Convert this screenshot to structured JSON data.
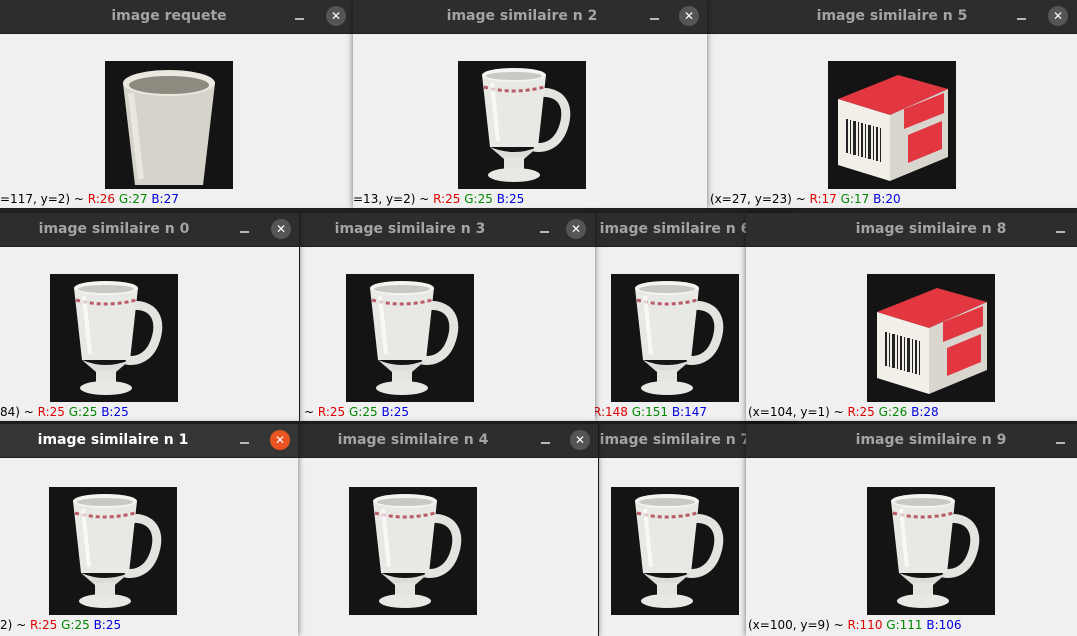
{
  "windows": [
    {
      "id": "requete",
      "title": "image requete",
      "image": "cup-icon",
      "status": {
        "coord": "=117, y=2)",
        "sep": " ~ ",
        "r": "R:26",
        "g": "G:27",
        "b": "B:27"
      }
    },
    {
      "id": "n2",
      "title": "image similaire n 2",
      "image": "mug-icon",
      "status": {
        "coord": "=13, y=2)",
        "sep": " ~ ",
        "r": "R:25",
        "g": "G:25",
        "b": "B:25"
      }
    },
    {
      "id": "n5",
      "title": "image similaire n 5",
      "image": "tylenol-box-icon",
      "status": {
        "coord": "(x=27, y=23)",
        "sep": " ~ ",
        "r": "R:17",
        "g": "G:17",
        "b": "B:20"
      }
    },
    {
      "id": "n0",
      "title": "image similaire n 0",
      "image": "mug-icon",
      "status": {
        "coord": "84)",
        "sep": " ~ ",
        "r": "R:25",
        "g": "G:25",
        "b": "B:25"
      }
    },
    {
      "id": "n3",
      "title": "image similaire n 3",
      "image": "mug-icon",
      "status": {
        "coord": "",
        "sep": " ~ ",
        "r": "R:25",
        "g": "G:25",
        "b": "B:25"
      }
    },
    {
      "id": "n6",
      "title": "image similaire n 6",
      "image": "mug-icon",
      "status": {
        "coord": "",
        "sep": "",
        "r": "R:148",
        "g": "G:151",
        "b": "B:147"
      }
    },
    {
      "id": "n8",
      "title": "image similaire n 8",
      "image": "tylenol-box-icon",
      "status": {
        "coord": "(x=104, y=1)",
        "sep": " ~ ",
        "r": "R:25",
        "g": "G:26",
        "b": "B:28"
      }
    },
    {
      "id": "n1",
      "title": "image similaire n 1",
      "image": "mug-icon",
      "status": {
        "coord": "2)",
        "sep": " ~ ",
        "r": "R:25",
        "g": "G:25",
        "b": "B:25"
      }
    },
    {
      "id": "n4",
      "title": "image similaire n 4",
      "image": "mug-icon",
      "status": {
        "coord": "",
        "sep": "",
        "r": "",
        "g": "",
        "b": ""
      }
    },
    {
      "id": "n7",
      "title": "image similaire n 7",
      "image": "mug-icon",
      "status": {
        "coord": "",
        "sep": "",
        "r": "",
        "g": "",
        "b": ""
      }
    },
    {
      "id": "n9",
      "title": "image similaire n 9",
      "image": "mug-icon",
      "status": {
        "coord": "(x=100, y=9)",
        "sep": " ~ ",
        "r": "R:110",
        "g": "G:111",
        "b": "B:106"
      }
    }
  ],
  "icons": {
    "minimize": "minimize-icon",
    "close": "close-icon"
  },
  "colors": {
    "titlebar": "#2d2d2d",
    "close_active": "#e95420",
    "close_inactive": "#555555",
    "red": "#e00000",
    "green": "#008800",
    "blue": "#0000e0"
  }
}
